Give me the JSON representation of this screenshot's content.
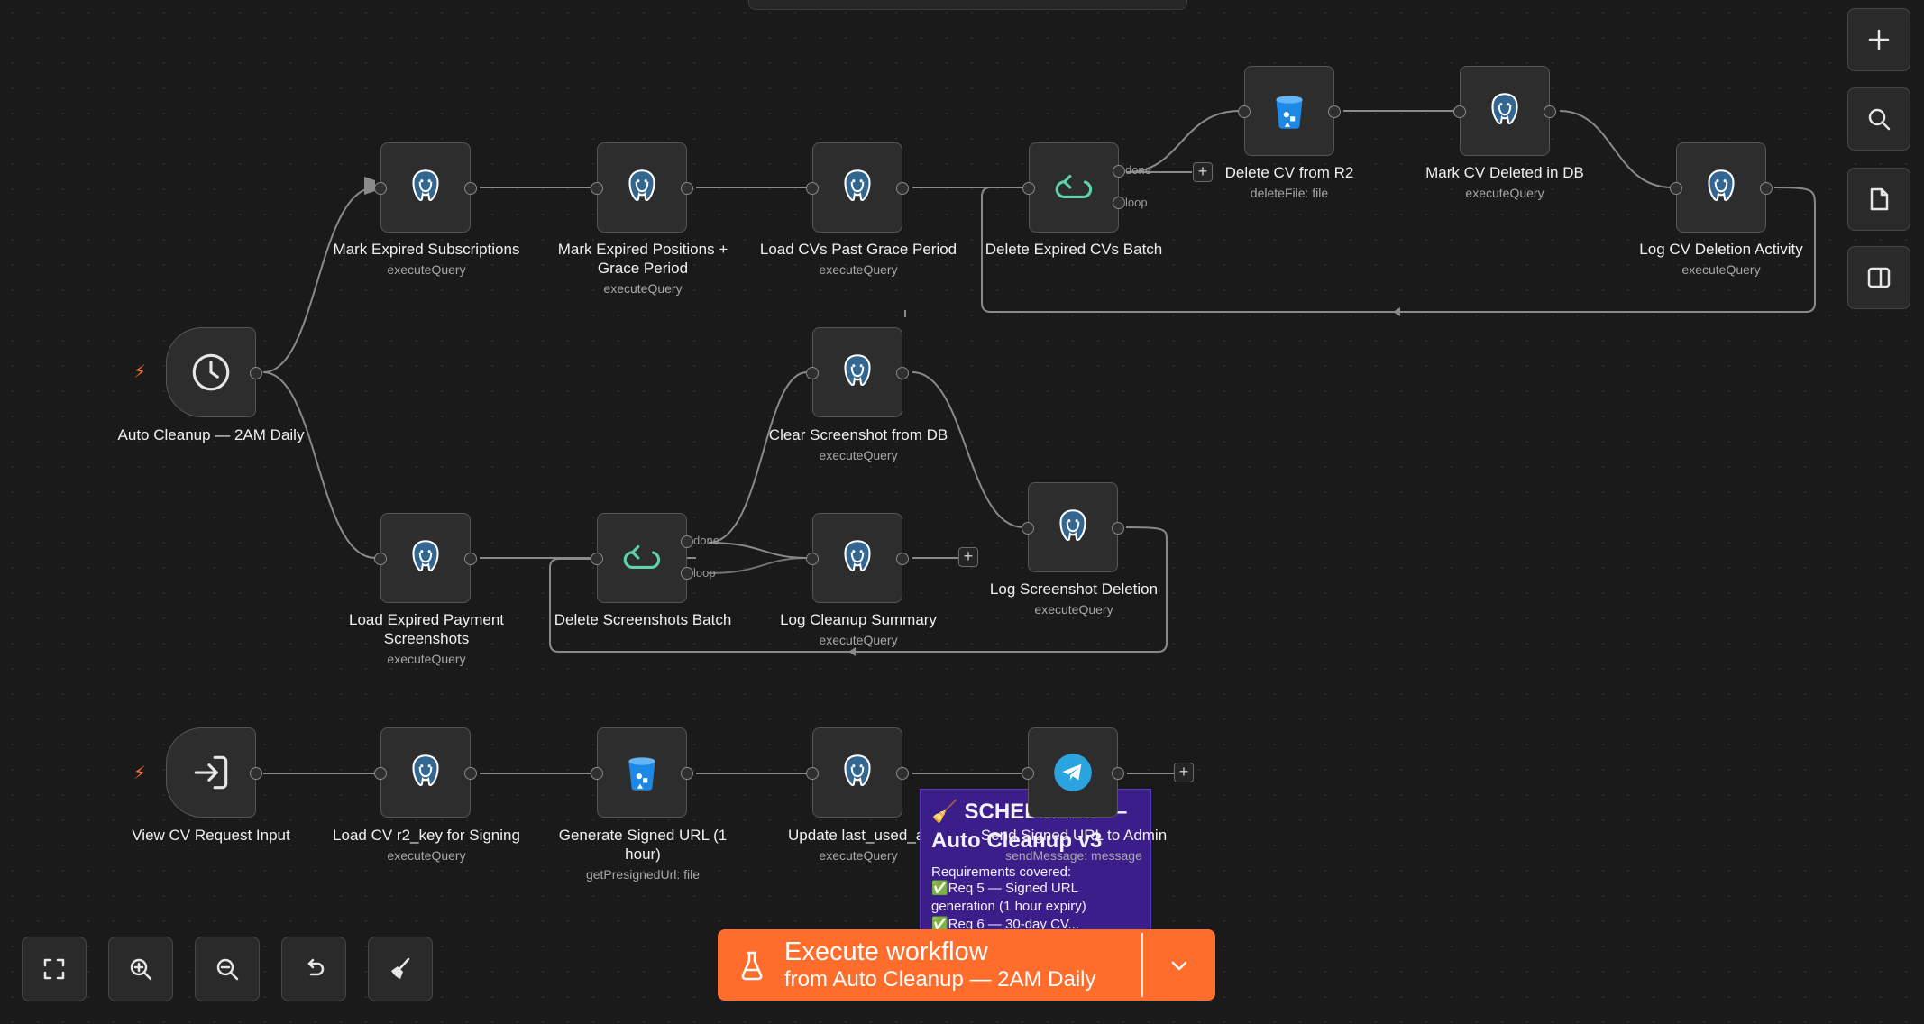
{
  "workflow_nodes": {
    "mark_expired_subscriptions": {
      "label": "Mark Expired Subscriptions",
      "sub": "executeQuery"
    },
    "mark_expired_positions": {
      "label": "Mark Expired Positions + Grace Period",
      "sub": "executeQuery"
    },
    "load_cvs_past_grace": {
      "label": "Load CVs Past Grace Period",
      "sub": "executeQuery"
    },
    "delete_expired_cvs_batch": {
      "label": "Delete Expired CVs Batch",
      "port_done": "done",
      "port_loop": "loop"
    },
    "delete_cv_from_r2": {
      "label": "Delete CV from R2",
      "sub": "deleteFile: file"
    },
    "mark_cv_deleted": {
      "label": "Mark CV Deleted in DB",
      "sub": "executeQuery"
    },
    "log_cv_deletion": {
      "label": "Log CV Deletion Activity",
      "sub": "executeQuery"
    },
    "auto_cleanup_trigger": {
      "label": "Auto Cleanup — 2AM Daily"
    },
    "clear_screenshot": {
      "label": "Clear Screenshot from DB",
      "sub": "executeQuery"
    },
    "log_screenshot_deletion": {
      "label": "Log Screenshot Deletion",
      "sub": "executeQuery"
    },
    "load_expired_payment": {
      "label": "Load Expired Payment Screenshots",
      "sub": "executeQuery"
    },
    "delete_screenshots_batch": {
      "label": "Delete Screenshots Batch",
      "port_done": "done",
      "port_loop": "loop"
    },
    "log_cleanup_summary": {
      "label": "Log Cleanup Summary",
      "sub": "executeQuery"
    },
    "view_cv_request": {
      "label": "View CV Request Input"
    },
    "load_cv_r2_key": {
      "label": "Load CV r2_key for Signing",
      "sub": "executeQuery"
    },
    "generate_signed_url": {
      "label": "Generate Signed URL (1 hour)",
      "sub": "getPresignedUrl: file"
    },
    "update_last_used": {
      "label": "Update last_used_at",
      "sub": "executeQuery"
    },
    "send_signed_url": {
      "label": "Send Signed URL to Admin",
      "sub": "sendMessage: message"
    }
  },
  "sticky_note": {
    "line1": "🧹 SCHEDULED —",
    "line2": "Auto Cleanup v3",
    "line3": "Requirements covered:",
    "line4": "✅Req 5 — Signed URL generation (1 hour expiry)",
    "line5": "✅Req 6 — 30-day CV..."
  },
  "execute_button": {
    "label": "Execute workflow",
    "from_label": "from Auto Cleanup — 2AM Daily"
  },
  "icons": {
    "right_toolbar": [
      "plus-icon",
      "search-icon",
      "sticky-note-icon",
      "panel-toggle-icon"
    ],
    "bottom_toolbar": [
      "fit-view-icon",
      "zoom-in-icon",
      "zoom-out-icon",
      "reset-zoom-icon",
      "tidy-up-icon"
    ]
  },
  "colors": {
    "background": "#1a1a1a",
    "accent": "#ff6d2d",
    "postgres": "#336791",
    "loop": "#5fd3a7",
    "r2_bucket": "#1e88e5",
    "telegram": "#2aa3df",
    "sticky": "#3b1e8a"
  }
}
